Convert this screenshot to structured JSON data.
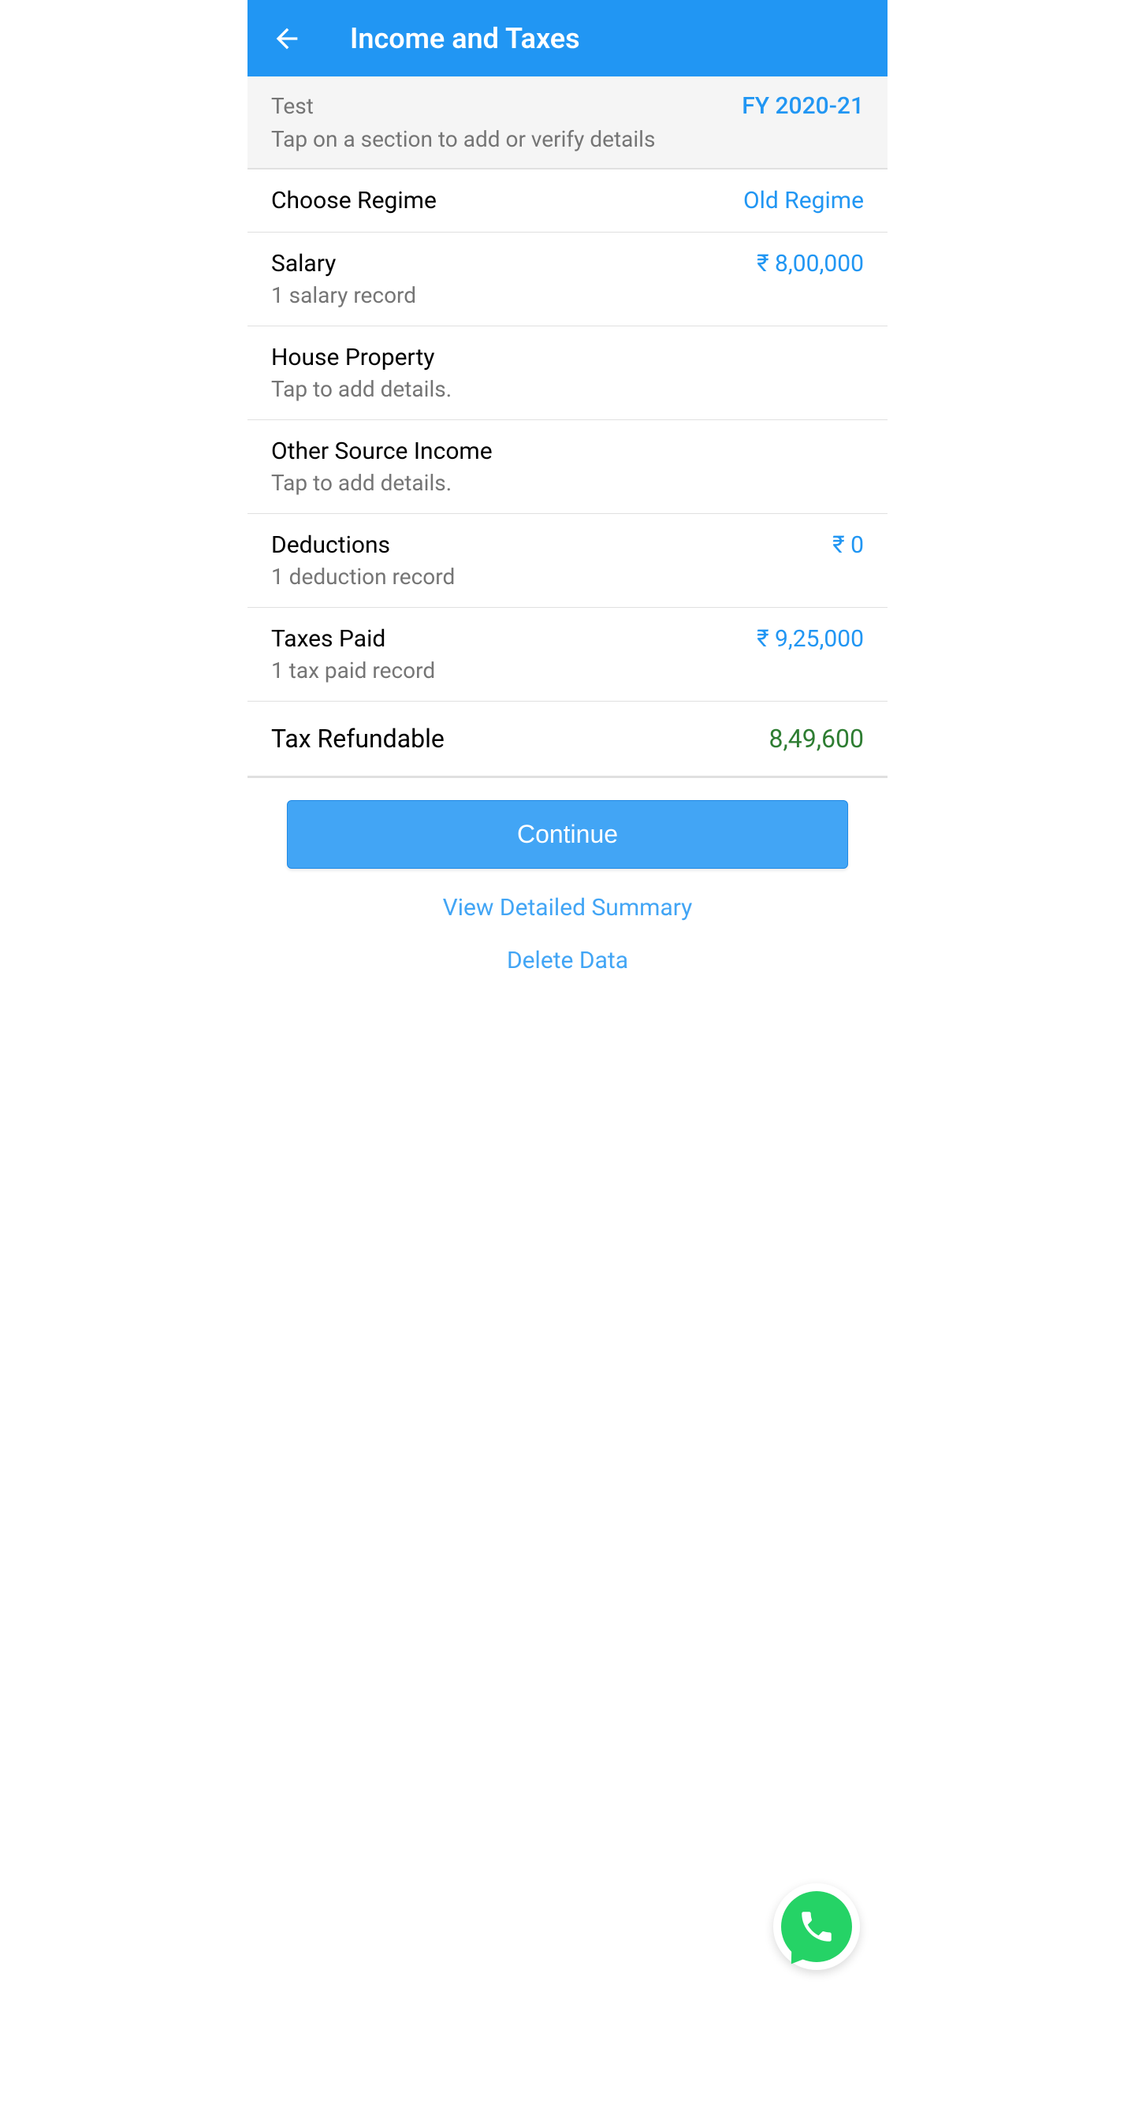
{
  "header": {
    "title": "Income and Taxes"
  },
  "info": {
    "name": "Test",
    "fy": "FY 2020-21",
    "subtitle": "Tap on a section to add or verify details"
  },
  "sections": {
    "regime": {
      "title": "Choose Regime",
      "value": "Old Regime"
    },
    "salary": {
      "title": "Salary",
      "subtitle": "1 salary record",
      "value": "₹ 8,00,000"
    },
    "houseProperty": {
      "title": "House Property",
      "subtitle": "Tap to add details."
    },
    "otherSource": {
      "title": "Other Source Income",
      "subtitle": "Tap to add details."
    },
    "deductions": {
      "title": "Deductions",
      "subtitle": "1 deduction record",
      "value": "₹ 0"
    },
    "taxesPaid": {
      "title": "Taxes Paid",
      "subtitle": "1 tax paid record",
      "value": "₹ 9,25,000"
    }
  },
  "refund": {
    "label": "Tax Refundable",
    "value": "8,49,600"
  },
  "actions": {
    "continue": "Continue",
    "viewSummary": "View Detailed Summary",
    "deleteData": "Delete Data"
  }
}
